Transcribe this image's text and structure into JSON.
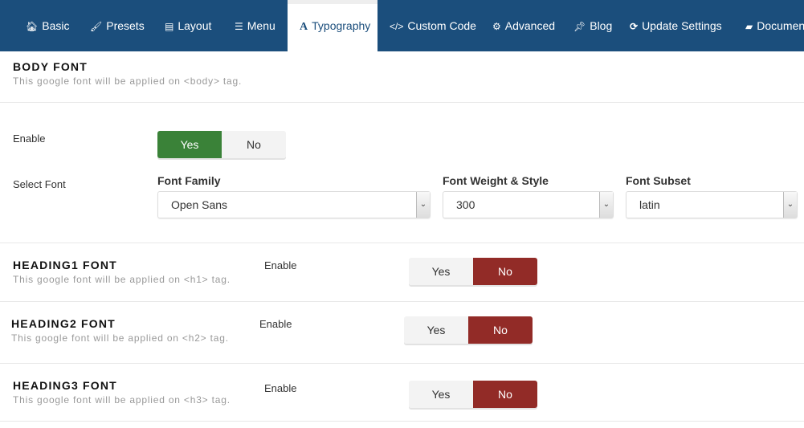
{
  "nav": {
    "tabs": [
      {
        "label": "Basic",
        "icon": "home-icon",
        "glyph": "🏠︎"
      },
      {
        "label": "Presets",
        "icon": "paintbrush-icon",
        "glyph": "🖌︎"
      },
      {
        "label": "Layout",
        "icon": "layout-icon",
        "glyph": "▤"
      },
      {
        "label": "Menu",
        "icon": "list-icon",
        "glyph": "☰"
      },
      {
        "label": "Typography",
        "icon": "font-icon",
        "glyph": "A"
      },
      {
        "label": "Custom Code",
        "icon": "code-icon",
        "glyph": "</>"
      },
      {
        "label": "Advanced",
        "icon": "gear-icon",
        "glyph": "⚙"
      },
      {
        "label": "Blog",
        "icon": "pin-icon",
        "glyph": "📌︎"
      },
      {
        "label": "Update Settings",
        "icon": "refresh-icon",
        "glyph": "⟳"
      },
      {
        "label": "Documentation",
        "icon": "book-icon",
        "glyph": "▰"
      }
    ],
    "active": "Typography"
  },
  "body_font": {
    "title": "BODY FONT",
    "subtitle": "This google font will be applied on <body> tag.",
    "enable_label": "Enable",
    "yes": "Yes",
    "no": "No",
    "enabled": true,
    "select_font_label": "Select Font",
    "family_label": "Font Family",
    "family_value": "Open Sans",
    "weight_label": "Font Weight & Style",
    "weight_value": "300",
    "subset_label": "Font Subset",
    "subset_value": "latin",
    "arrow": "⌄"
  },
  "headings": [
    {
      "title": "HEADING1 FONT",
      "subtitle": "This google font will be applied on <h1> tag.",
      "enable_label": "Enable",
      "yes": "Yes",
      "no": "No",
      "enabled": false
    },
    {
      "title": "HEADING2 FONT",
      "subtitle": "This google font will be applied on <h2> tag.",
      "enable_label": "Enable",
      "yes": "Yes",
      "no": "No",
      "enabled": false
    },
    {
      "title": "HEADING3 FONT",
      "subtitle": "This google font will be applied on <h3> tag.",
      "enable_label": "Enable",
      "yes": "Yes",
      "no": "No",
      "enabled": false
    }
  ],
  "colors": {
    "nav": "#1b4e7c",
    "yes_active": "#3a8238",
    "no_active": "#922b27"
  }
}
